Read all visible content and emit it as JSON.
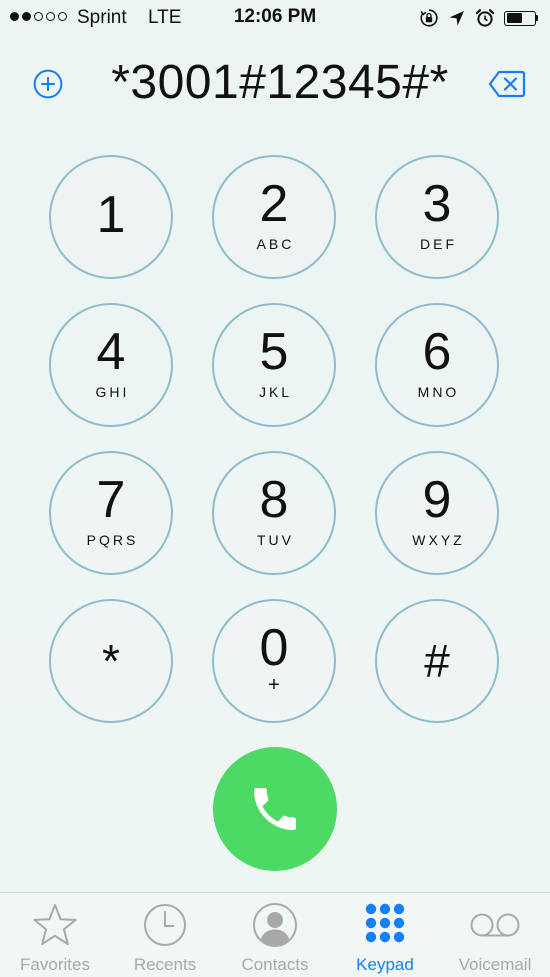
{
  "status_bar": {
    "carrier": "Sprint",
    "network": "LTE",
    "time": "12:06 PM",
    "signal_bars_filled": 2,
    "signal_bars_total": 5
  },
  "dialer": {
    "number": "*3001#12345#*"
  },
  "keypad": {
    "keys": [
      {
        "digit": "1",
        "letters": ""
      },
      {
        "digit": "2",
        "letters": "ABC"
      },
      {
        "digit": "3",
        "letters": "DEF"
      },
      {
        "digit": "4",
        "letters": "GHI"
      },
      {
        "digit": "5",
        "letters": "JKL"
      },
      {
        "digit": "6",
        "letters": "MNO"
      },
      {
        "digit": "7",
        "letters": "PQRS"
      },
      {
        "digit": "8",
        "letters": "TUV"
      },
      {
        "digit": "9",
        "letters": "WXYZ"
      },
      {
        "digit": "*",
        "letters": ""
      },
      {
        "digit": "0",
        "letters": "+"
      },
      {
        "digit": "#",
        "letters": ""
      }
    ]
  },
  "tab_bar": {
    "tabs": [
      {
        "label": "Favorites",
        "icon": "star-icon",
        "active": false
      },
      {
        "label": "Recents",
        "icon": "clock-icon",
        "active": false
      },
      {
        "label": "Contacts",
        "icon": "person-icon",
        "active": false
      },
      {
        "label": "Keypad",
        "icon": "keypad-icon",
        "active": true
      },
      {
        "label": "Voicemail",
        "icon": "voicemail-icon",
        "active": false
      }
    ]
  },
  "colors": {
    "key_border": "#8fbccc",
    "call_green": "#4cd964",
    "accent_blue": "#157efb",
    "inactive_gray": "#a9a9a9"
  }
}
